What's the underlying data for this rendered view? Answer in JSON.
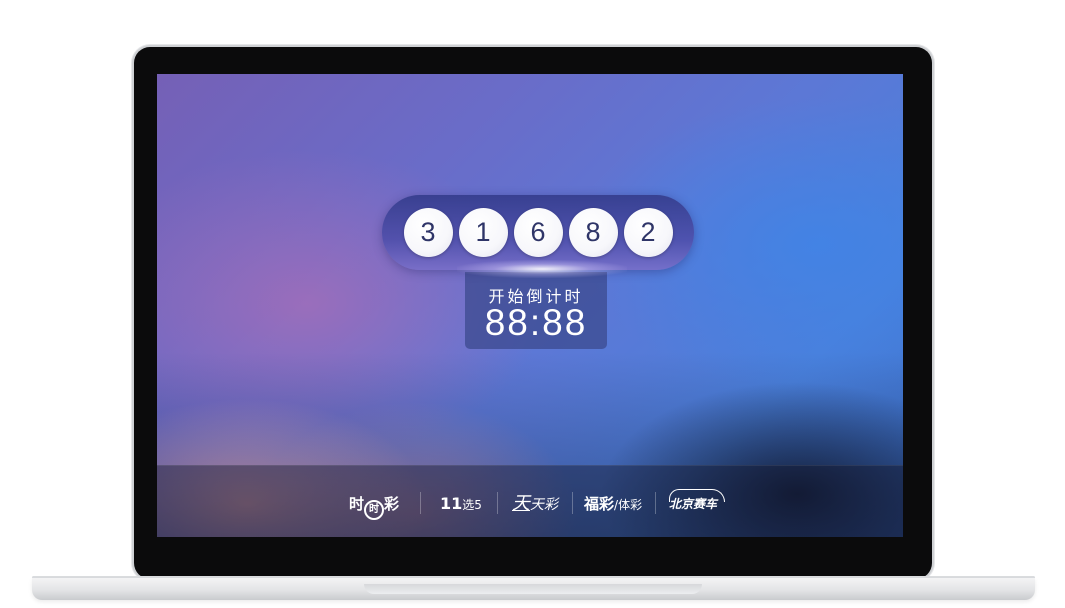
{
  "lottery": {
    "balls": [
      "3",
      "1",
      "6",
      "8",
      "2"
    ]
  },
  "countdown": {
    "label": "开始倒计时",
    "time": "88:88"
  },
  "logos": {
    "shishicai": {
      "left": "时",
      "ring": "时",
      "right": "彩"
    },
    "eleven_five": {
      "number": "11",
      "rest": "选5"
    },
    "tiantiancai": {
      "first": "天",
      "rest": "天彩"
    },
    "fucai_ticai": {
      "fucai": "福彩",
      "slash": "/",
      "ticai": "体彩"
    },
    "beijing_racing": {
      "text": "北京赛车"
    }
  },
  "colors": {
    "ball_text": "#2f3568",
    "countdown_text": "#ffffff",
    "bar_accent": "#4e4eaa"
  }
}
